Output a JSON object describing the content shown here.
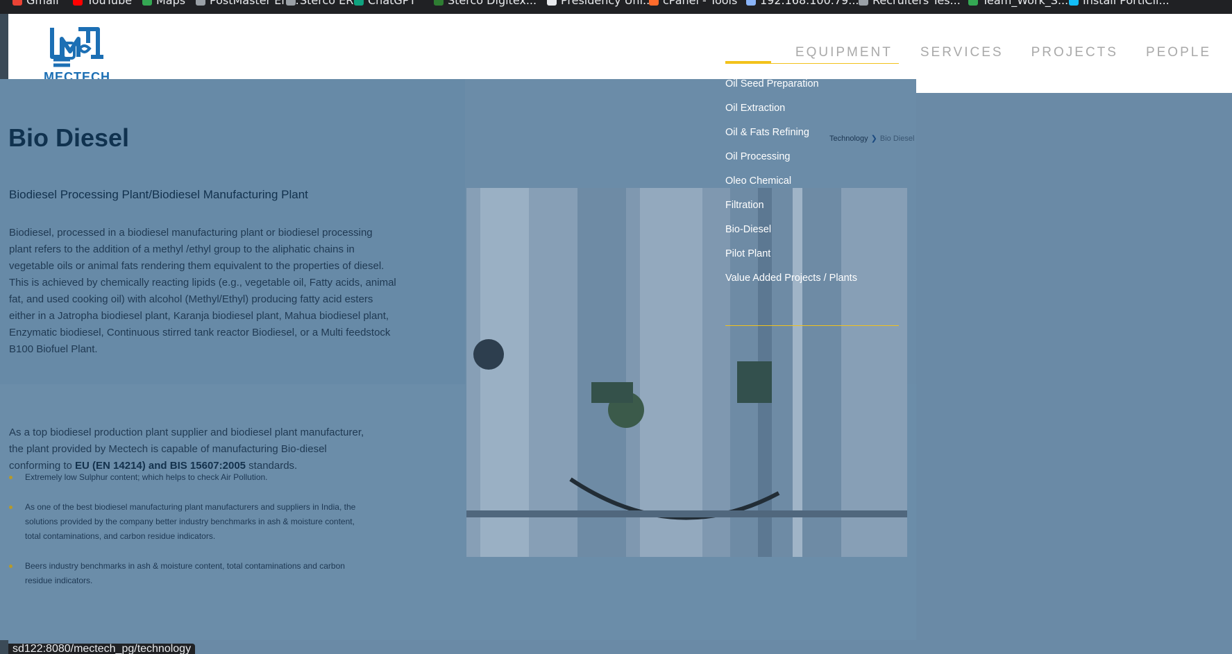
{
  "bookmarks": [
    {
      "label": "Gmail",
      "icon": "gmail-icon",
      "color": "#ea4335"
    },
    {
      "label": "YouTube",
      "icon": "youtube-icon",
      "color": "#ff0000"
    },
    {
      "label": "Maps",
      "icon": "maps-icon",
      "color": "#34a853"
    },
    {
      "label": "PostMaster En...",
      "icon": "globe-icon",
      "color": "#9aa0a6"
    },
    {
      "label": "Sterco ERP",
      "icon": "globe-icon",
      "color": "#9aa0a6"
    },
    {
      "label": "ChatGPT",
      "icon": "chatgpt-icon",
      "color": "#10a37f"
    },
    {
      "label": "Sterco Digitex...",
      "icon": "grid-icon",
      "color": "#2e7d32"
    },
    {
      "label": "Presidency Uni...",
      "icon": "doc-icon",
      "color": "#e8eaed"
    },
    {
      "label": "cPanel - Tools",
      "icon": "cpanel-icon",
      "color": "#ff6c2c"
    },
    {
      "label": "192.168.100.79...",
      "icon": "server-icon",
      "color": "#8ab4f8"
    },
    {
      "label": "Recruiters Tes...",
      "icon": "globe-icon",
      "color": "#9aa0a6"
    },
    {
      "label": "Team_Work_S...",
      "icon": "sheet-icon",
      "color": "#34a853"
    },
    {
      "label": "Install PortiCli...",
      "icon": "portainer-icon",
      "color": "#13bef9"
    }
  ],
  "header": {
    "logo_text": "MECTECH",
    "nav": [
      "EQUIPMENT",
      "SERVICES",
      "PROJECTS",
      "PEOPLE"
    ]
  },
  "colors": {
    "brand_blue": "#1c6fb4",
    "accent_yellow": "#f2c21b",
    "overlay": "#6a8aa6",
    "title": "#10324f"
  },
  "page": {
    "title": "Bio Diesel",
    "subtitle": "Biodiesel Processing Plant/Biodiesel Manufacturing Plant",
    "intro": "Biodiesel, processed in a biodiesel manufacturing plant or biodiesel processing plant refers to the addition of a methyl /ethyl group to the aliphatic chains in vegetable oils or animal fats rendering them equivalent to the properties of diesel. This is achieved by chemically reacting lipids (e.g., vegetable oil, Fatty acids, animal fat, and used cooking oil) with alcohol (Methyl/Ethyl) producing fatty acid esters either in a Jatropha biodiesel plant, Karanja biodiesel plant, Mahua biodiesel plant, Enzymatic biodiesel, Continuous stirred tank reactor Biodiesel, or a Multi feedstock B100 Biofuel Plant.",
    "para2_prefix": "As a top biodiesel production plant supplier and biodiesel plant manufacturer, the plant provided by Mectech is capable of manufacturing Bio-diesel conforming to ",
    "para2_bold": "EU (EN 14214) and BIS 15607:2005",
    "para2_suffix": " standards.",
    "bullets": [
      "Extremely low Sulphur content; which helps to check Air Pollution.",
      "As one of the best biodiesel manufacturing plant manufacturers and suppliers in India, the solutions provided by the company better industry benchmarks in ash & moisture content, total contaminations, and carbon residue indicators.",
      "Beers industry benchmarks in ash & moisture content, total contaminations and carbon residue indicators."
    ]
  },
  "breadcrumb": {
    "parent": "Technology",
    "current": "Bio Diesel"
  },
  "dropdown": {
    "items": [
      "Oil Seed Preparation",
      "Oil Extraction",
      "Oil & Fats Refining",
      "Oil Processing",
      "Oleo Chemical",
      "Filtration",
      "Bio-Diesel",
      "Pilot Plant",
      "Value Added Projects / Plants"
    ]
  },
  "status_bar": {
    "url": "sd122:8080/mectech_pg/technology"
  }
}
